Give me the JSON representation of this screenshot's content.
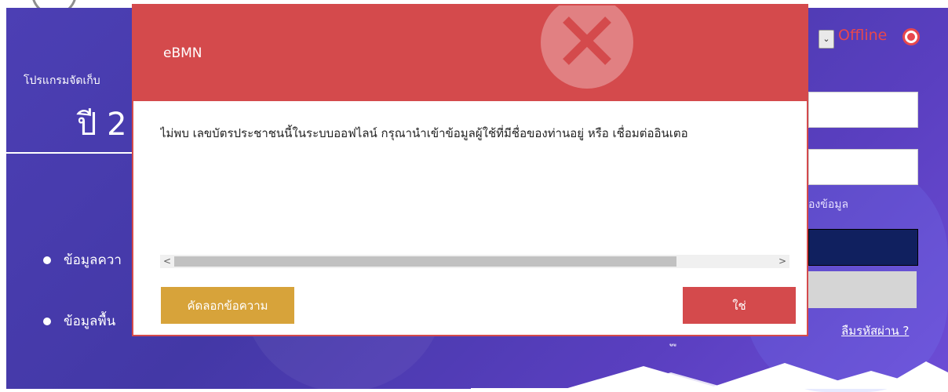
{
  "background": {
    "program_label": "โปรแกรมจัดเก็บ",
    "year_label": "ปี 2",
    "bullets": [
      "ข้อมูลควา",
      "ข้อมูลพื้น"
    ],
    "status_label": "Offline",
    "field_hint": "องข้อมูล",
    "forgot_password": "ลืมรหัสผ่าน ?",
    "footer_fragment": "ู ู",
    "colors": {
      "banner": "#4c3fb4",
      "offline": "#e8474d"
    }
  },
  "dialog": {
    "title": "eBMN",
    "icon": "error-x-icon",
    "message": "ไม่พบ เลขบัตรประชาชนนี้ในระบบออฟไลน์ กรุณานำเข้าข้อมูลผู้ใช้ที่มีชื่อของท่านอยู่ หรือ เชื่อมต่ออินเตอ",
    "scroll_left": "<",
    "scroll_right": ">",
    "copy_button": "คัดลอกข้อความ",
    "ok_button": "ใช่",
    "colors": {
      "header": "#d44a4c",
      "copy": "#d7a33a",
      "ok": "#d44a4c"
    }
  }
}
